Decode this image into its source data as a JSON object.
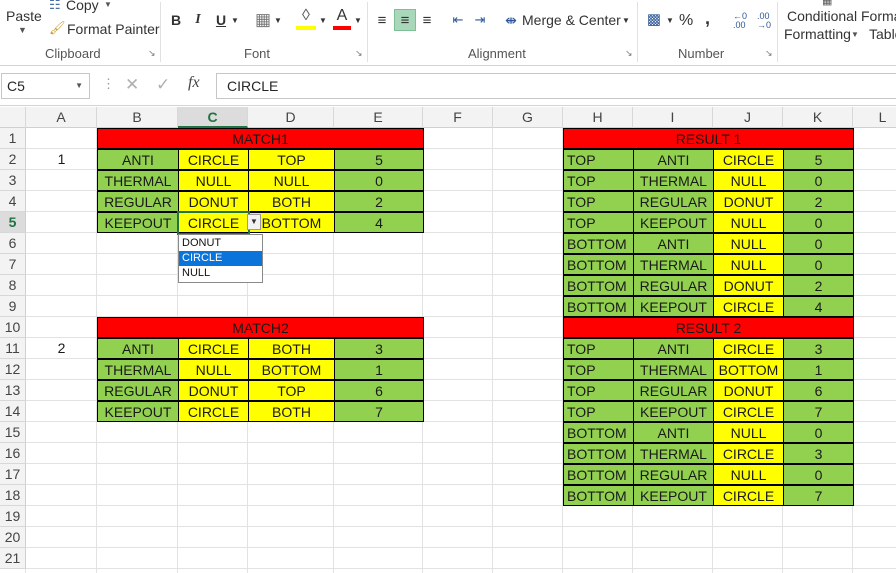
{
  "ribbon": {
    "paste": "Paste",
    "copy": "Copy",
    "format_painter": "Format Painter",
    "groups": {
      "clipboard": "Clipboard",
      "font": "Font",
      "alignment": "Alignment",
      "number": "Number"
    },
    "merge_center": "Merge & Center",
    "percent": "%",
    "comma": ",",
    "conditional1": "Conditional",
    "conditional2": "Formatting",
    "format_as1": "Forma",
    "format_as2": "Table",
    "bold": "B",
    "italic": "I",
    "underline": "U",
    "font_color": "A",
    "inc_dec": "←.0",
    "dec_dec": ".00"
  },
  "formula_bar": {
    "name_box": "C5",
    "fx": "fx",
    "content": "CIRCLE"
  },
  "columns": [
    "A",
    "B",
    "C",
    "D",
    "E",
    "F",
    "G",
    "H",
    "I",
    "J",
    "K",
    "L"
  ],
  "selected_column": "C",
  "rows": [
    "1",
    "2",
    "3",
    "4",
    "5",
    "6",
    "7",
    "8",
    "9",
    "10",
    "11",
    "12",
    "13",
    "14",
    "15",
    "16",
    "17",
    "18",
    "19",
    "20",
    "21"
  ],
  "selected_row": "5",
  "colors": {
    "header_red": "#ff0000",
    "green": "#92d050",
    "yellow": "#ffff00",
    "selection": "#217346"
  },
  "labels": {
    "a2": "1",
    "a11": "2"
  },
  "match1": {
    "title": "MATCH1",
    "rows": [
      [
        "ANTI",
        "CIRCLE",
        "TOP",
        "5"
      ],
      [
        "THERMAL",
        "NULL",
        "NULL",
        "0"
      ],
      [
        "REGULAR",
        "DONUT",
        "BOTH",
        "2"
      ],
      [
        "KEEPOUT",
        "CIRCLE",
        "BOTTOM",
        "4"
      ]
    ]
  },
  "match2": {
    "title": "MATCH2",
    "rows": [
      [
        "ANTI",
        "CIRCLE",
        "BOTH",
        "3"
      ],
      [
        "THERMAL",
        "NULL",
        "BOTTOM",
        "1"
      ],
      [
        "REGULAR",
        "DONUT",
        "TOP",
        "6"
      ],
      [
        "KEEPOUT",
        "CIRCLE",
        "BOTH",
        "7"
      ]
    ]
  },
  "result1": {
    "title": "RESULT 1",
    "rows": [
      [
        "TOP",
        "ANTI",
        "CIRCLE",
        "5"
      ],
      [
        "TOP",
        "THERMAL",
        "NULL",
        "0"
      ],
      [
        "TOP",
        "REGULAR",
        "DONUT",
        "2"
      ],
      [
        "TOP",
        "KEEPOUT",
        "NULL",
        "0"
      ],
      [
        "BOTTOM",
        "ANTI",
        "NULL",
        "0"
      ],
      [
        "BOTTOM",
        "THERMAL",
        "NULL",
        "0"
      ],
      [
        "BOTTOM",
        "REGULAR",
        "DONUT",
        "2"
      ],
      [
        "BOTTOM",
        "KEEPOUT",
        "CIRCLE",
        "4"
      ]
    ]
  },
  "result2": {
    "title": "RESULT 2",
    "rows": [
      [
        "TOP",
        "ANTI",
        "CIRCLE",
        "3"
      ],
      [
        "TOP",
        "THERMAL",
        "BOTTOM",
        "1"
      ],
      [
        "TOP",
        "REGULAR",
        "DONUT",
        "6"
      ],
      [
        "TOP",
        "KEEPOUT",
        "CIRCLE",
        "7"
      ],
      [
        "BOTTOM",
        "ANTI",
        "NULL",
        "0"
      ],
      [
        "BOTTOM",
        "THERMAL",
        "CIRCLE",
        "3"
      ],
      [
        "BOTTOM",
        "REGULAR",
        "NULL",
        "0"
      ],
      [
        "BOTTOM",
        "KEEPOUT",
        "CIRCLE",
        "7"
      ]
    ]
  },
  "dropdown": {
    "options": [
      "DONUT",
      "CIRCLE",
      "NULL"
    ],
    "selected": "CIRCLE"
  }
}
